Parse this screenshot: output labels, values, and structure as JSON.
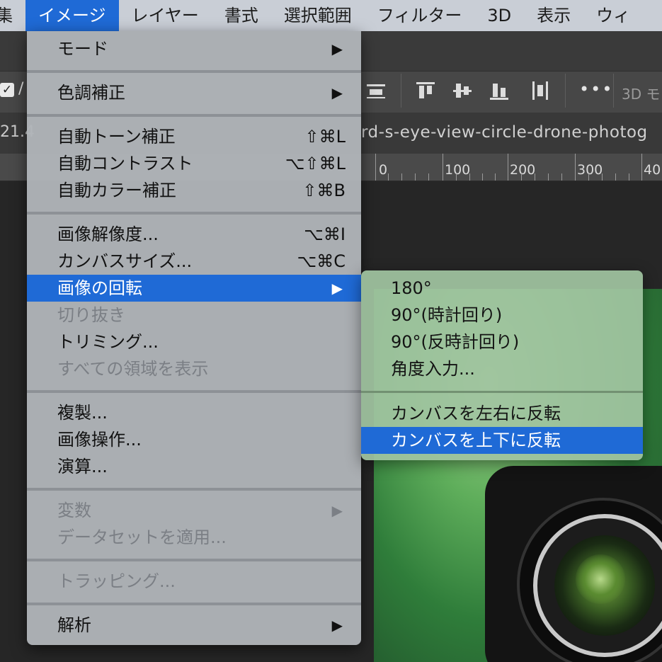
{
  "menubar": {
    "items": [
      "集",
      "イメージ",
      "レイヤー",
      "書式",
      "選択範囲",
      "フィルター",
      "3D",
      "表示",
      "ウィ"
    ]
  },
  "document": {
    "zoom_fragment": "21.4",
    "tab_title": "rd-s-eye-view-circle-drone-photog"
  },
  "ruler": {
    "labels": [
      "0",
      "100",
      "200",
      "300",
      "40"
    ]
  },
  "options_bar": {
    "more_label": "•••",
    "threed_mode_label": "3D モ",
    "checkbox_label": "/"
  },
  "image_menu": {
    "items": [
      {
        "label": "モード",
        "arrow": "▶"
      },
      {
        "label": "色調補正",
        "arrow": "▶"
      },
      {
        "label": "自動トーン補正",
        "shortcut": "⇧⌘L"
      },
      {
        "label": "自動コントラスト",
        "shortcut": "⌥⇧⌘L"
      },
      {
        "label": "自動カラー補正",
        "shortcut": "⇧⌘B"
      },
      {
        "label": "画像解像度...",
        "shortcut": "⌥⌘I"
      },
      {
        "label": "カンバスサイズ...",
        "shortcut": "⌥⌘C"
      },
      {
        "label": "画像の回転",
        "arrow": "▶"
      },
      {
        "label": "切り抜き"
      },
      {
        "label": "トリミング..."
      },
      {
        "label": "すべての領域を表示"
      },
      {
        "label": "複製..."
      },
      {
        "label": "画像操作..."
      },
      {
        "label": "演算..."
      },
      {
        "label": "変数",
        "arrow": "▶"
      },
      {
        "label": "データセットを適用..."
      },
      {
        "label": "トラッピング..."
      },
      {
        "label": "解析",
        "arrow": "▶"
      }
    ]
  },
  "rotate_submenu": {
    "items": [
      {
        "label": "180°"
      },
      {
        "label": "90°(時計回り)"
      },
      {
        "label": "90°(反時計回り)"
      },
      {
        "label": "角度入力..."
      },
      {
        "label": "カンバスを左右に反転"
      },
      {
        "label": "カンバスを上下に反転"
      }
    ]
  },
  "colors": {
    "highlight": "#1f6ad6",
    "menu_bg": "#b0b4b8",
    "disabled_text": "#7b7f85"
  }
}
